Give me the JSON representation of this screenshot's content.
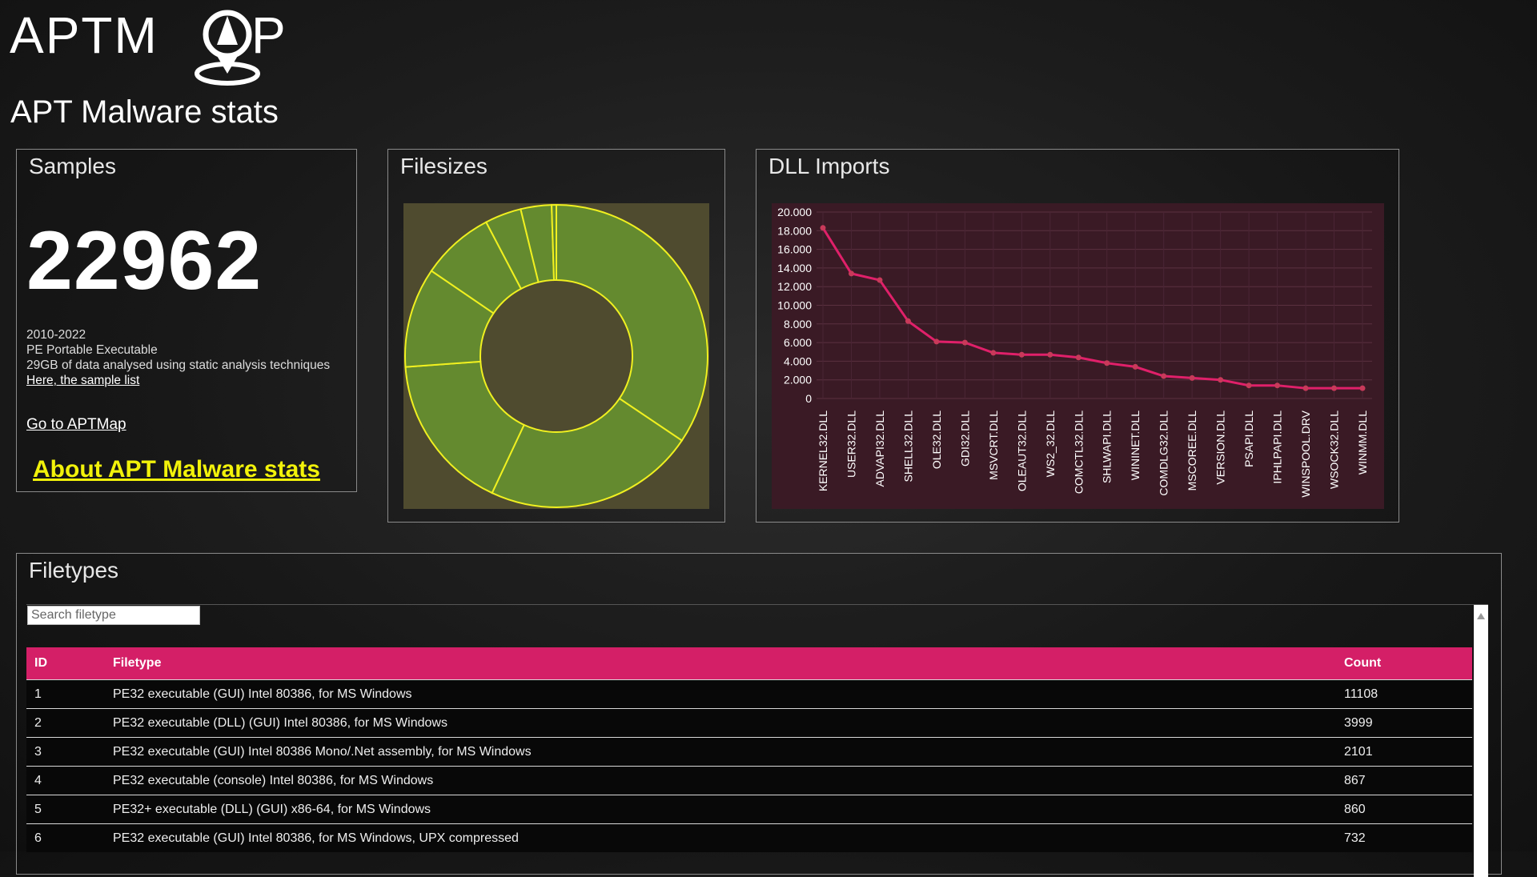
{
  "logo": {
    "text": "APTMAP"
  },
  "page_title": "APT Malware stats",
  "samples": {
    "title": "Samples",
    "count": "22962",
    "lines": [
      "2010-2022",
      "PE Portable Executable",
      "29GB of data analysed using static analysis techniques"
    ],
    "sample_list_link": "Here, the sample list",
    "goto_link": "Go to APTMap",
    "about_link": "About APT Malware stats"
  },
  "filesizes": {
    "title": "Filesizes",
    "chart_data": {
      "type": "pie",
      "values": [
        34.5,
        22.6,
        16.9,
        10.7,
        7.8,
        3.9,
        3.3,
        0.5
      ],
      "colors": {
        "fill": "#648a2f",
        "stroke": "#f0f020",
        "background": "#4f4b2f"
      }
    }
  },
  "dll": {
    "title": "DLL Imports",
    "chart_data": {
      "type": "line",
      "categories": [
        "KERNEL32.DLL",
        "USER32.DLL",
        "ADVAPI32.DLL",
        "SHELL32.DLL",
        "OLE32.DLL",
        "GDI32.DLL",
        "MSVCRT.DLL",
        "OLEAUT32.DLL",
        "WS2_32.DLL",
        "COMCTL32.DLL",
        "SHLWAPI.DLL",
        "WININET.DLL",
        "COMDLG32.DLL",
        "MSCOREE.DLL",
        "VERSION.DLL",
        "PSAPI.DLL",
        "IPHLPAPI.DLL",
        "WINSPOOL.DRV",
        "WSOCK32.DLL",
        "WINMM.DLL"
      ],
      "values": [
        18300,
        13400,
        12700,
        8300,
        6100,
        6000,
        4900,
        4700,
        4700,
        4400,
        3800,
        3400,
        2400,
        2200,
        2000,
        1400,
        1400,
        1100,
        1100,
        1100
      ],
      "yticks": [
        "0",
        "2.000",
        "4.000",
        "6.000",
        "8.000",
        "10.000",
        "12.000",
        "14.000",
        "16.000",
        "18.000",
        "20.000"
      ],
      "ylim": [
        0,
        20000
      ],
      "colors": {
        "line": "#e0206a",
        "background": "#3a1a25"
      }
    }
  },
  "filetypes": {
    "title": "Filetypes",
    "search_placeholder": "Search filetype",
    "headers": [
      "ID",
      "Filetype",
      "Count"
    ],
    "rows": [
      [
        "1",
        "PE32 executable (GUI) Intel 80386, for MS Windows",
        "11108"
      ],
      [
        "2",
        "PE32 executable (DLL) (GUI) Intel 80386, for MS Windows",
        "3999"
      ],
      [
        "3",
        "PE32 executable (GUI) Intel 80386 Mono/.Net assembly, for MS Windows",
        "2101"
      ],
      [
        "4",
        "PE32 executable (console) Intel 80386, for MS Windows",
        "867"
      ],
      [
        "5",
        "PE32+ executable (DLL) (GUI) x86-64, for MS Windows",
        "860"
      ],
      [
        "6",
        "PE32 executable (GUI) Intel 80386, for MS Windows, UPX compressed",
        "732"
      ]
    ]
  }
}
